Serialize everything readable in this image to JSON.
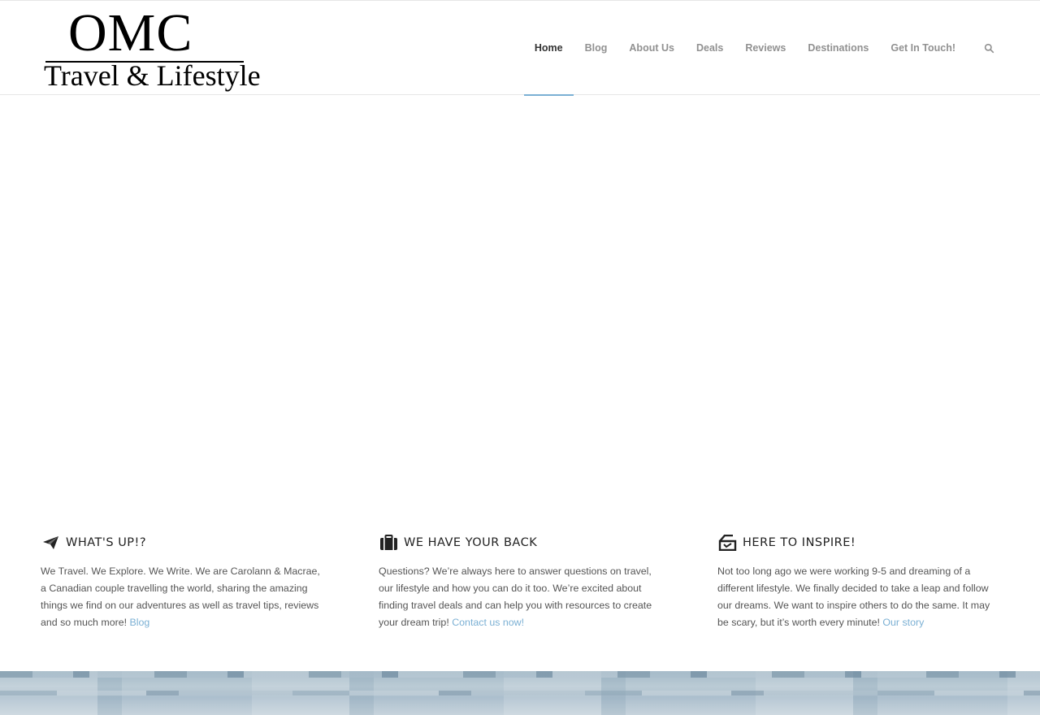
{
  "logo": {
    "line1": "OMC",
    "line2": "Travel & Lifestyle"
  },
  "nav": {
    "items": [
      "Home",
      "Blog",
      "About Us",
      "Deals",
      "Reviews",
      "Destinations",
      "Get In Touch!"
    ],
    "active": "Home",
    "search_icon": "search-icon"
  },
  "columns": [
    {
      "icon": "paper-plane-icon",
      "title": "WHAT'S UP!?",
      "text": "We Travel. We Explore. We Write. We are Carolann & Macrae, a Canadian couple travelling the world, sharing the amazing things we find on our adventures as well as travel tips, reviews and so much more! ",
      "link": "Blog"
    },
    {
      "icon": "suitcase-icon",
      "title": "WE HAVE YOUR BACK",
      "text": "Questions? We’re always here to answer questions on travel, our lifestyle and how you can do it too. We’re excited about finding travel deals and can help you with resources to create your dream trip! ",
      "link": "Contact us now!"
    },
    {
      "icon": "inbox-icon",
      "title": "HERE TO INSPIRE!",
      "text": "Not too long ago we were working 9-5 and dreaming of a different lifestyle. We finally decided to take a leap and follow our dreams. We want to inspire others to do the same. It may be scary, but it’s worth every minute! ",
      "link": "Our story"
    }
  ],
  "colors": {
    "accent": "#7bb0d4",
    "nav_text": "#919191"
  }
}
